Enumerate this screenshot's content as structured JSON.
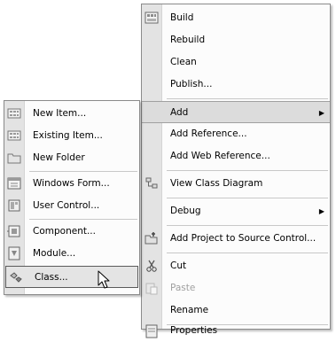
{
  "main_menu": {
    "items": [
      {
        "label": "Build",
        "icon": "build-icon"
      },
      {
        "label": "Rebuild"
      },
      {
        "label": "Clean"
      },
      {
        "label": "Publish..."
      },
      {
        "label": "Add",
        "submenu": true
      },
      {
        "label": "Add Reference..."
      },
      {
        "label": "Add Web Reference..."
      },
      {
        "label": "View Class Diagram",
        "icon": "class-diagram-icon"
      },
      {
        "label": "Debug",
        "submenu": true
      },
      {
        "label": "Add Project to Source Control...",
        "icon": "source-control-icon"
      },
      {
        "label": "Cut",
        "icon": "cut-icon"
      },
      {
        "label": "Paste",
        "icon": "paste-icon",
        "disabled": true
      },
      {
        "label": "Rename"
      },
      {
        "label": "Properties",
        "icon": "properties-icon"
      }
    ],
    "submenu_arrow": "▶"
  },
  "add_submenu": {
    "items": [
      {
        "label": "New Item...",
        "icon": "new-item-icon"
      },
      {
        "label": "Existing Item...",
        "icon": "existing-item-icon"
      },
      {
        "label": "New Folder",
        "icon": "folder-icon"
      },
      {
        "label": "Windows Form...",
        "icon": "windows-form-icon"
      },
      {
        "label": "User Control...",
        "icon": "user-control-icon"
      },
      {
        "label": "Component...",
        "icon": "component-icon"
      },
      {
        "label": "Module...",
        "icon": "module-icon"
      },
      {
        "label": "Class...",
        "icon": "class-icon"
      }
    ]
  }
}
